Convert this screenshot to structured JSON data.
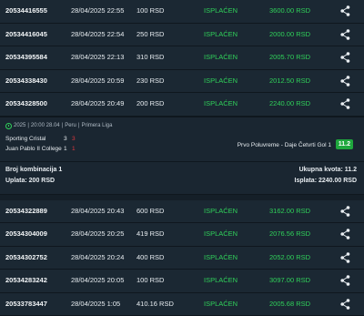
{
  "rows_top": [
    {
      "id": "20534416555",
      "date": "28/04/2025 22:55",
      "amount": "100 RSD",
      "status": "ISPLAĆEN",
      "win": "3600.00 RSD"
    },
    {
      "id": "20534416045",
      "date": "28/04/2025 22:54",
      "amount": "250 RSD",
      "status": "ISPLAĆEN",
      "win": "2000.00 RSD"
    },
    {
      "id": "20534395584",
      "date": "28/04/2025 22:13",
      "amount": "310 RSD",
      "status": "ISPLAĆEN",
      "win": "2005.70 RSD"
    },
    {
      "id": "20534338430",
      "date": "28/04/2025 20:59",
      "amount": "230 RSD",
      "status": "ISPLAĆEN",
      "win": "2012.50 RSD"
    },
    {
      "id": "20534328500",
      "date": "28/04/2025 20:49",
      "amount": "200 RSD",
      "status": "ISPLAĆEN",
      "win": "2240.00 RSD"
    }
  ],
  "match": {
    "meta": {
      "year": "2025",
      "time": "20:00 28.04",
      "country": "Peru",
      "league": "Primera Liga"
    },
    "home": {
      "name": "Sporting Cristal",
      "score": "3",
      "score_ht": "3"
    },
    "away": {
      "name": "Juan Pablo II College",
      "score": "1",
      "score_ht": "1"
    },
    "bet": "Prvo Poluvreme - Daje Četvrti Gol 1",
    "odd": "11.2"
  },
  "summary": {
    "combinations": "Broj kombinacija 1",
    "stake": "Uplata: 200 RSD",
    "total_odd": "Ukupna kvota: 11.2",
    "payout": "Isplata: 2240.00 RSD"
  },
  "rows_bottom": [
    {
      "id": "20534322889",
      "date": "28/04/2025 20:43",
      "amount": "600 RSD",
      "status": "ISPLAĆEN",
      "win": "3162.00 RSD"
    },
    {
      "id": "20534304009",
      "date": "28/04/2025 20:25",
      "amount": "419 RSD",
      "status": "ISPLAĆEN",
      "win": "2076.56 RSD"
    },
    {
      "id": "20534302752",
      "date": "28/04/2025 20:24",
      "amount": "400 RSD",
      "status": "ISPLAĆEN",
      "win": "2052.00 RSD"
    },
    {
      "id": "20534283242",
      "date": "28/04/2025 20:05",
      "amount": "100 RSD",
      "status": "ISPLAĆEN",
      "win": "3097.00 RSD"
    },
    {
      "id": "20533783447",
      "date": "28/04/2025 1:05",
      "amount": "410.16 RSD",
      "status": "ISPLAĆEN",
      "win": "2005.68 RSD"
    }
  ],
  "colors": {
    "accent_green": "#30d15a",
    "badge_green": "#1fa73d",
    "score_red": "#e0383e",
    "row_bg": "#1b2833"
  },
  "icons": {
    "share": "share-icon",
    "clock": "clock-icon"
  }
}
